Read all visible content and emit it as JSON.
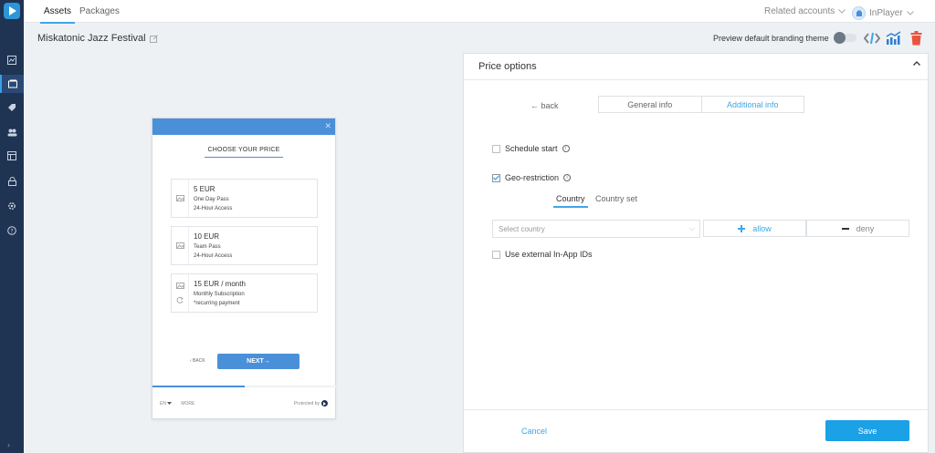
{
  "nav": {
    "tabs": [
      {
        "label": "Assets",
        "active": true
      },
      {
        "label": "Packages",
        "active": false
      }
    ],
    "related_accounts": "Related accounts",
    "user": "InPlayer"
  },
  "rail": {
    "icons": [
      "dashboard-icon",
      "assets-icon",
      "tag-icon",
      "users-icon",
      "report-icon",
      "lock-icon",
      "settings-icon",
      "help-icon"
    ],
    "active_index": 1
  },
  "asset": {
    "title": "Miskatonic Jazz Festival",
    "preview_label": "Preview default branding theme"
  },
  "preview": {
    "choose_label": "CHOOSE YOUR PRICE",
    "prices": [
      {
        "amount": "5 EUR",
        "name": "One Day Pass",
        "access": "24-Hour Access",
        "recurring": false
      },
      {
        "amount": "10 EUR",
        "name": "Team Pass",
        "access": "24-Hour Access",
        "recurring": false
      },
      {
        "amount": "15 EUR / month",
        "name": "Monthly Subscription",
        "access": "*recurring payment",
        "recurring": true
      }
    ],
    "back_label": "‹ BACK",
    "next_label": "NEXT→",
    "progress": 0.5,
    "lang": "EN",
    "more": "MORE",
    "protected_by": "Protected by"
  },
  "panel": {
    "title": "Price options",
    "back": "← back",
    "tabs": [
      {
        "label": "General info",
        "active": false
      },
      {
        "label": "Additional info",
        "active": true
      }
    ],
    "schedule_label": "Schedule start",
    "schedule_checked": false,
    "geo_label": "Geo-restriction",
    "geo_checked": true,
    "geo_tabs": [
      {
        "label": "Country",
        "active": true
      },
      {
        "label": "Country set",
        "active": false
      }
    ],
    "country_placeholder": "Select country",
    "allow_label": "allow",
    "deny_label": "deny",
    "external_label": "Use external In-App IDs",
    "external_checked": false,
    "cancel_label": "Cancel",
    "save_label": "Save"
  },
  "colors": {
    "accent": "#3ea6e8",
    "brand_blue": "#4a90d9",
    "rail": "#1f3352",
    "delete": "#e8553e"
  }
}
